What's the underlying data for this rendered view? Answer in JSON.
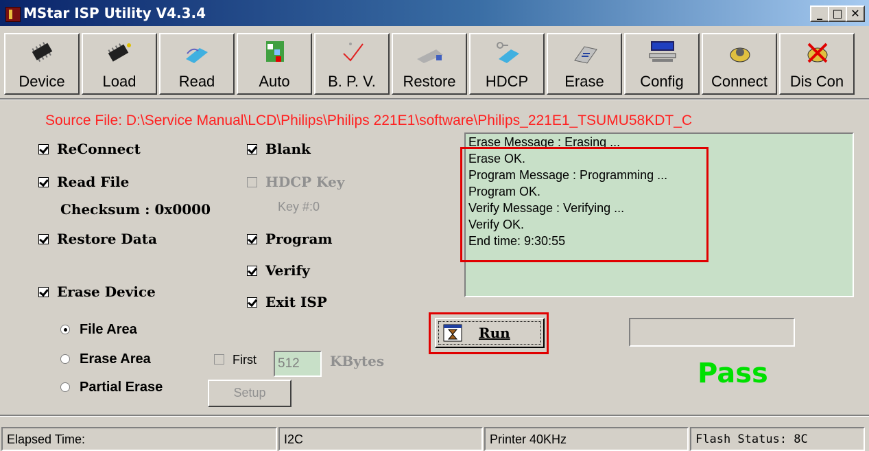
{
  "app": {
    "title": "MStar ISP Utility V4.3.4"
  },
  "window_controls": {
    "minimize": "_",
    "maximize": "□",
    "close": "✕"
  },
  "toolbar": {
    "buttons": [
      {
        "label": "Device",
        "icon": "chip-icon"
      },
      {
        "label": "Load",
        "icon": "chip-load-icon"
      },
      {
        "label": "Read",
        "icon": "read-icon"
      },
      {
        "label": "Auto",
        "icon": "auto-icon"
      },
      {
        "label": "B. P. V.",
        "icon": "checkmark-icon"
      },
      {
        "label": "Restore",
        "icon": "restore-icon"
      },
      {
        "label": "HDCP",
        "icon": "hdcp-icon"
      },
      {
        "label": "Erase",
        "icon": "erase-icon"
      },
      {
        "label": "Config",
        "icon": "config-icon"
      },
      {
        "label": "Connect",
        "icon": "connect-icon"
      },
      {
        "label": "Dis Con",
        "icon": "disconnect-icon"
      }
    ]
  },
  "source_file": "Source File: D:\\Service Manual\\LCD\\Philips\\Philips 221E1\\software\\Philips_221E1_TSUMU58KDT_C",
  "options": {
    "reconnect": {
      "label": "ReConnect",
      "checked": true
    },
    "read_file": {
      "label": "Read File",
      "checked": true
    },
    "checksum": "Checksum : 0x0000",
    "restore_data": {
      "label": "Restore Data",
      "checked": true
    },
    "erase_device": {
      "label": "Erase Device",
      "checked": true
    },
    "blank": {
      "label": "Blank",
      "checked": true
    },
    "hdcp_key": {
      "label": "HDCP Key",
      "checked": false,
      "enabled": false
    },
    "key_number": "Key #:0",
    "program": {
      "label": "Program",
      "checked": true
    },
    "verify": {
      "label": "Verify",
      "checked": true
    },
    "exit_isp": {
      "label": "Exit ISP",
      "checked": true
    }
  },
  "erase_mode": {
    "options": [
      "File Area",
      "Erase Area",
      "Partial Erase"
    ],
    "selected": "File Area"
  },
  "first_kbytes": {
    "first_label": "First",
    "value": "512",
    "unit_label": "KBytes",
    "checked": false
  },
  "setup_label": "Setup",
  "log": {
    "lines": [
      "Erase Message : Erasing ...",
      "Erase OK.",
      "Program Message : Programming ...",
      "Program OK.",
      "Verify Message : Verifying ...",
      "Verify OK.",
      "End time: 9:30:55"
    ]
  },
  "run_label": "Run",
  "result": "Pass",
  "statusbar": {
    "elapsed": "Elapsed Time:",
    "interface": "I2C",
    "printer": "Printer  40KHz",
    "flash": "Flash Status: 8C"
  },
  "colors": {
    "source_text": "#ff2020",
    "pass": "#00e000",
    "highlight": "#e00000",
    "log_bg": "#c8e0c8"
  }
}
